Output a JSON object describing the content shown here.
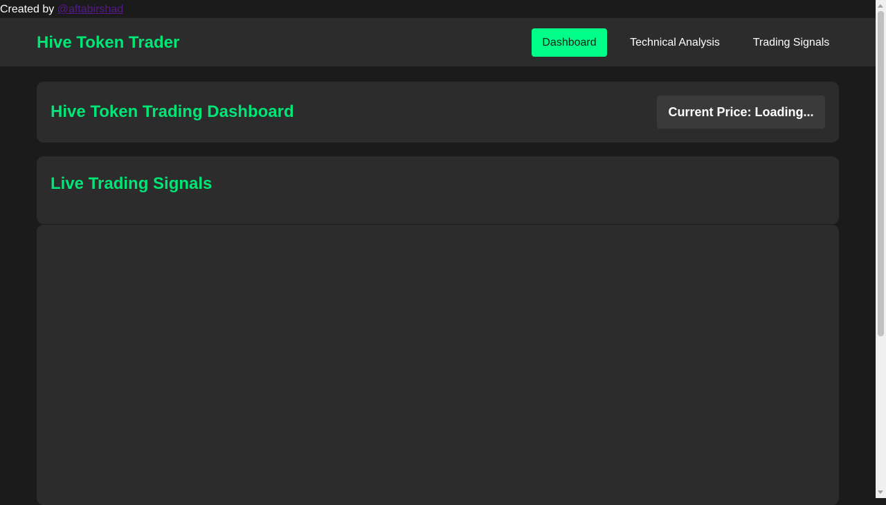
{
  "credit": {
    "prefix": "Created by ",
    "author": "@aftabirshad"
  },
  "navbar": {
    "brand": "Hive Token Trader",
    "items": [
      {
        "label": "Dashboard",
        "active": true
      },
      {
        "label": "Technical Analysis",
        "active": false
      },
      {
        "label": "Trading Signals",
        "active": false
      }
    ]
  },
  "dashboard": {
    "title": "Hive Token Trading Dashboard",
    "price_label": "Current Price: Loading..."
  },
  "signals": {
    "title": "Live Trading Signals"
  },
  "colors": {
    "accent": "#00e676",
    "active_nav": "#00ff88",
    "page_bg": "#1b1b1b",
    "card_bg": "#2c2c2c"
  }
}
